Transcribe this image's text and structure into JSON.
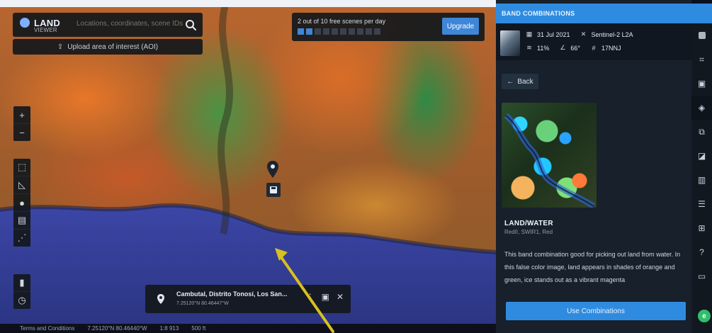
{
  "search": {
    "placeholder": "Locations, coordinates, scene IDs"
  },
  "logo": {
    "name": "LAND",
    "tagline": "VIEWER"
  },
  "upload": {
    "label": "Upload area of interest (AOI)"
  },
  "scenes": {
    "label": "2 out of 10 free scenes per day",
    "used": 2,
    "total": 10,
    "upgrade_label": "Upgrade"
  },
  "tools": {
    "zoom_in": "+",
    "zoom_out": "−"
  },
  "location": {
    "title": "Cambutal, Distrito Tonosí, Los San...",
    "coords": "7.25120°N 80.46447°W"
  },
  "status": {
    "terms": "Terms and Conditions",
    "coords": "7.25120°N 80.46440°W",
    "scale": "1:8 913",
    "scale_bar": "500 ft"
  },
  "panel": {
    "title": "BAND COMBINATIONS",
    "date": "31 Jul 2021",
    "satellite": "Sentinel-2 L2A",
    "cloud": "11%",
    "angle": "66°",
    "tile": "17NNJ",
    "back_label": "Back",
    "band_title": "LAND/WATER",
    "band_sub": "RedII, SWIR1, Red",
    "description": "This band combination good for picking out land from water. In this false color image, land appears in shades of orange and green, ice stands out as a vibrant magenta",
    "use_label": "Use Combinations"
  },
  "rail": {
    "badge": "e"
  },
  "colors": {
    "accent": "#2f8be0",
    "panel_bg": "#17202b"
  }
}
